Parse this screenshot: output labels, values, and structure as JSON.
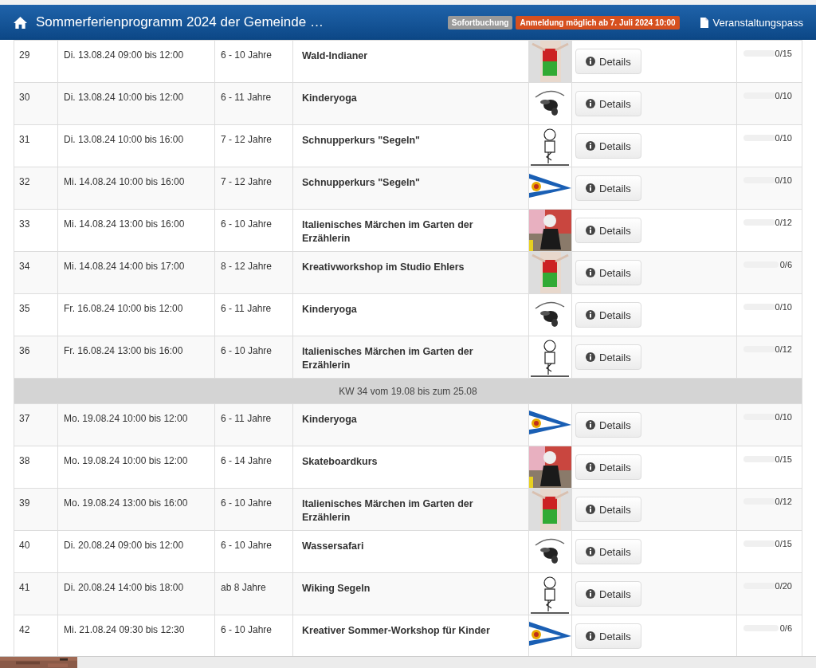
{
  "header": {
    "title": "Sommerferienprogramm 2024 der Gemeinde …",
    "badges": [
      {
        "kind": "neutral",
        "text": "Sofortbuchung"
      },
      {
        "kind": "warning",
        "text": "Anmeldung möglich ab 7. Juli 2024 10:00"
      }
    ],
    "pass_link": "Veranstaltungspass"
  },
  "table": {
    "rows": [
      {
        "kind": "event",
        "number": "29",
        "date": "Di. 13.08.24 09:00 bis 12:00",
        "age": "6 - 10 Jahre",
        "title": "Wald-Indianer",
        "button": "Details",
        "level": 0,
        "count": "0/15"
      },
      {
        "kind": "event",
        "number": "30",
        "date": "Di. 13.08.24 10:00 bis 12:00",
        "age": "6 - 11 Jahre",
        "title": "Kinderyoga",
        "button": "Details",
        "level": 0,
        "count": "0/10"
      },
      {
        "kind": "event",
        "number": "31",
        "date": "Di. 13.08.24 10:00 bis 16:00",
        "age": "7 - 12 Jahre",
        "title": "Schnupperkurs \"Segeln\"",
        "button": "Details",
        "level": 0,
        "count": "0/10"
      },
      {
        "kind": "event",
        "number": "32",
        "date": "Mi. 14.08.24 10:00 bis 16:00",
        "age": "7 - 12 Jahre",
        "title": "Schnupperkurs \"Segeln\"",
        "button": "Details",
        "level": 0,
        "count": "0/10"
      },
      {
        "kind": "event",
        "number": "33",
        "date": "Mi. 14.08.24 13:00 bis 16:00",
        "age": "6 - 10 Jahre",
        "title": "Italienisches Märchen im Garten der Erzählerin",
        "button": "Details",
        "level": 0,
        "count": "0/12"
      },
      {
        "kind": "event",
        "number": "34",
        "date": "Mi. 14.08.24 14:00 bis 17:00",
        "age": "8 - 12 Jahre",
        "title": "Kreativworkshop im Studio Ehlers",
        "button": "Details",
        "level": 0,
        "count": "0/6"
      },
      {
        "kind": "event",
        "number": "35",
        "date": "Fr. 16.08.24 10:00 bis 12:00",
        "age": "6 - 11 Jahre",
        "title": "Kinderyoga",
        "button": "Details",
        "level": 0,
        "count": "0/10"
      },
      {
        "kind": "event",
        "number": "36",
        "date": "Fr. 16.08.24 13:00 bis 16:00",
        "age": "6 - 10 Jahre",
        "title": "Italienisches Märchen im Garten der Erzählerin",
        "button": "Details",
        "level": 0,
        "count": "0/12"
      },
      {
        "kind": "week",
        "text": "KW 34 vom 19.08 bis zum 25.08"
      },
      {
        "kind": "event",
        "number": "37",
        "date": "Mo. 19.08.24 10:00 bis 12:00",
        "age": "6 - 11 Jahre",
        "title": "Kinderyoga",
        "button": "Details",
        "level": 0,
        "count": "0/10"
      },
      {
        "kind": "event",
        "number": "38",
        "date": "Mo. 19.08.24 10:00 bis 12:00",
        "age": "6 - 14 Jahre",
        "title": "Skateboardkurs",
        "button": "Details",
        "level": 0,
        "count": "0/15"
      },
      {
        "kind": "event",
        "number": "39",
        "date": "Mo. 19.08.24 13:00 bis 16:00",
        "age": "6 - 10 Jahre",
        "title": "Italienisches Märchen im Garten der Erzählerin",
        "button": "Details",
        "level": 0,
        "count": "0/12"
      },
      {
        "kind": "event",
        "number": "40",
        "date": "Di. 20.08.24 09:00 bis 12:00",
        "age": "6 - 10 Jahre",
        "title": "Wassersafari",
        "button": "Details",
        "level": 0,
        "count": "0/15"
      },
      {
        "kind": "event",
        "number": "41",
        "date": "Di. 20.08.24 14:00 bis 18:00",
        "age": "ab 8 Jahre",
        "title": "Wiking Segeln",
        "button": "Details",
        "level": 0,
        "count": "0/20"
      },
      {
        "kind": "event",
        "number": "42",
        "date": "Mi. 21.08.24 09:30 bis 12:30",
        "age": "6 - 10 Jahre",
        "title": "Kreativer Sommer-Workshop für Kinder",
        "button": "Details",
        "level": 0,
        "count": "0/6"
      }
    ]
  }
}
